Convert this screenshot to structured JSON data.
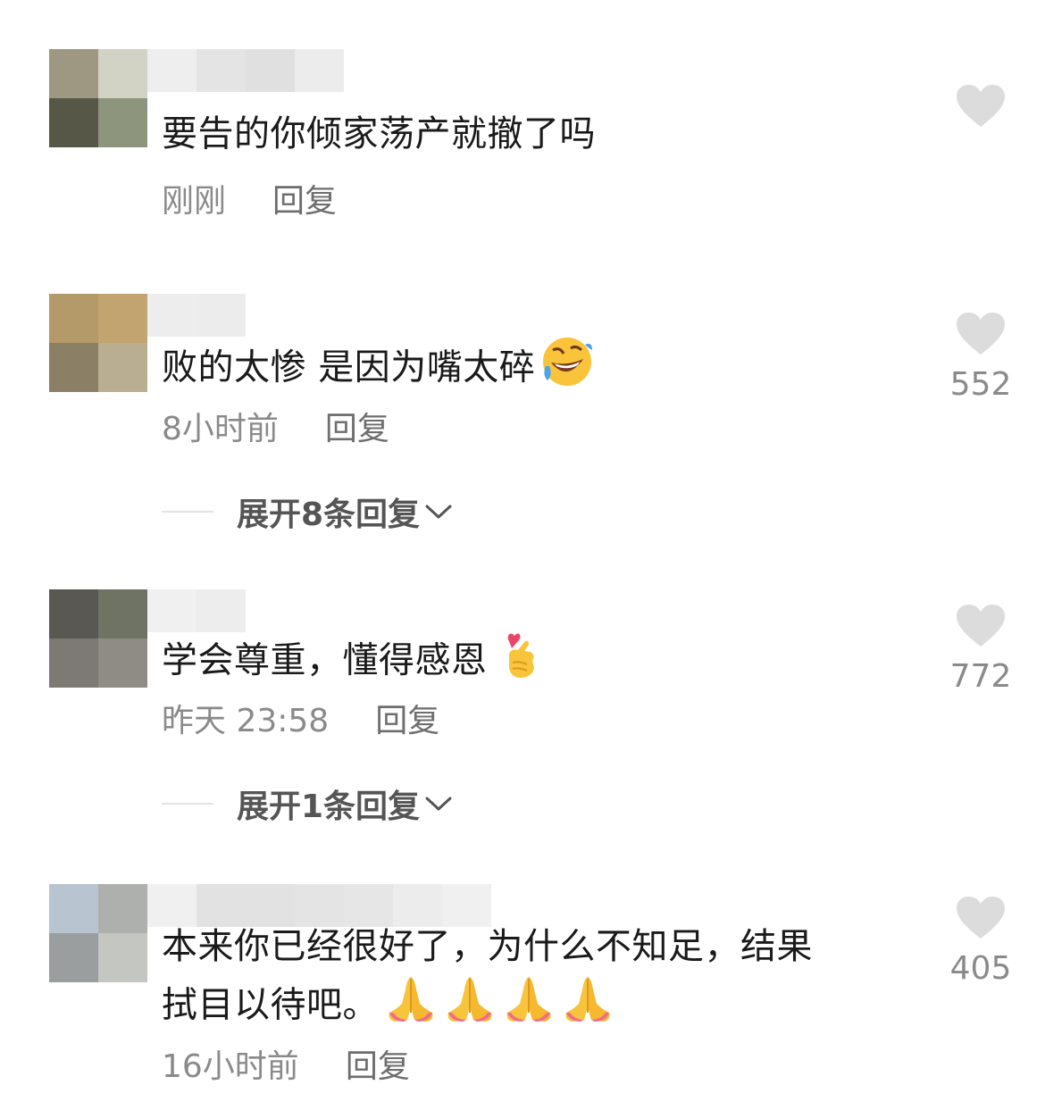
{
  "comments": [
    {
      "text": "要告的你倾家荡产就撤了吗",
      "time": "刚刚",
      "reply_label": "回复",
      "like_count": ""
    },
    {
      "text": "败的太惨 是因为嘴太碎",
      "emoji": "rolling-on-floor-laughing",
      "time": "8小时前",
      "reply_label": "回复",
      "like_count": "552",
      "expand_label": "展开8条回复"
    },
    {
      "text": "学会尊重，懂得感恩",
      "emoji": "finger-heart",
      "time": "昨天 23:58",
      "reply_label": "回复",
      "like_count": "772",
      "expand_label": "展开1条回复"
    },
    {
      "text_line1": "本来你已经很好了，为什么不知足，结果",
      "text_line2": "拭目以待吧。",
      "emoji": "folded-hands",
      "time": "16小时前",
      "reply_label": "回复",
      "like_count": "405"
    }
  ],
  "colors": {
    "text": "#1a1a1a",
    "meta": "#8a8a8a",
    "heart": "#dcdcdc"
  }
}
